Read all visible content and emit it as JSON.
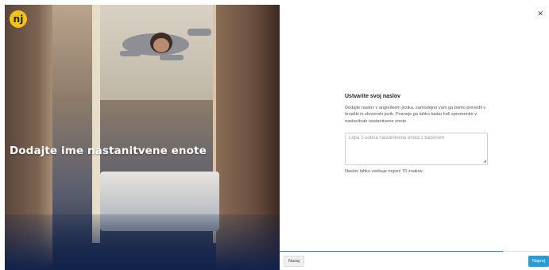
{
  "brand": {
    "logo_text": "nj",
    "accent_color": "#f3c21a"
  },
  "hero": {
    "headline": "Dodajte ime nastanitvene enote"
  },
  "form": {
    "title": "Ustvarite svoj naslov",
    "description": "Dodajte naslov v angleškem jeziku, samodejno vam ga bomo prevedli v hrvaški in slovenski jezik. Pozneje ga lahko kadar koli spremenite v nastavitvah nastanitvene enote.",
    "input_placeholder": "Lepa 1-sobna nastanitvena enota z bazenom",
    "hint": "Naslov lahko vsebuje največ 70 znakov."
  },
  "footer": {
    "back_label": "Nazaj",
    "next_label": "Naprej",
    "progress_fraction": 0.83,
    "primary_color": "#2a9bd3"
  },
  "close_icon": "close-icon"
}
